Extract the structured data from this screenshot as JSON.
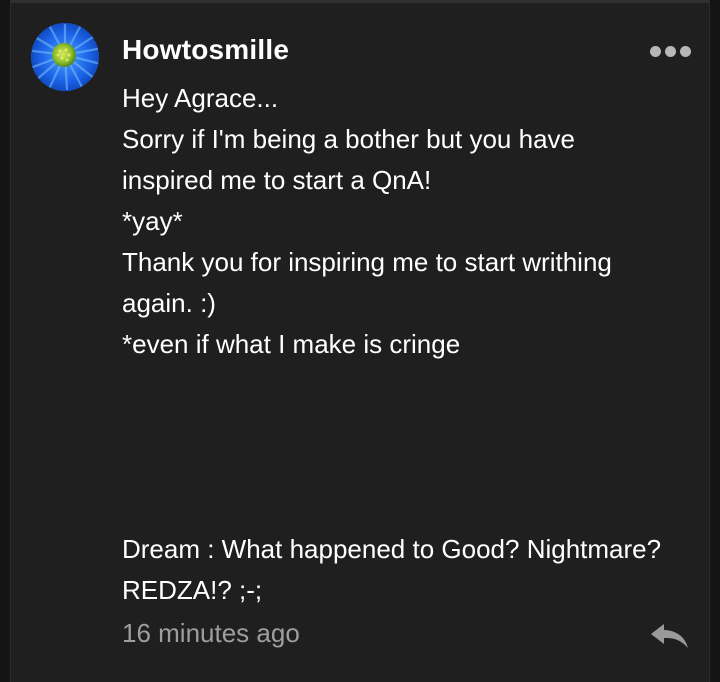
{
  "comment": {
    "username": "Howtosmille",
    "avatar_icon": "blue-flower-avatar",
    "menu_icon": "more-dots-icon",
    "body_lines": [
      "Hey Agrace...",
      "Sorry if I'm being a bother but you have",
      "inspired me to start a QnA!",
      "*yay*",
      "Thank you for inspiring me to start writhing",
      "again. :)",
      "*even if what I make is cringe"
    ],
    "reply_lines": [
      "Dream : What happened to Good? Nightmare?",
      "REDZA!? ;-;"
    ],
    "timestamp": "16 minutes ago",
    "reply_icon": "reply-arrow-icon"
  },
  "colors": {
    "card_background": "#1f1f20",
    "page_background": "#141414",
    "text_primary": "#ffffff",
    "text_secondary": "#9e9e9e",
    "icon_gray": "#b7b7b7",
    "avatar_blue": "#1e66e0",
    "avatar_center": "#8fbf2f"
  }
}
